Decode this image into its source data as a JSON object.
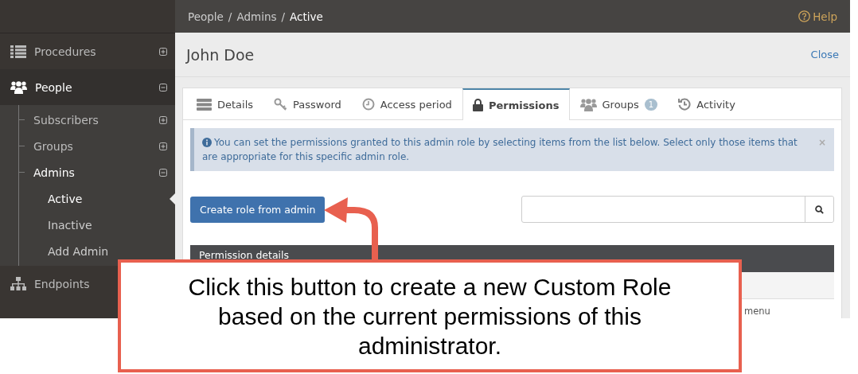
{
  "breadcrumb": [
    {
      "label": "People",
      "current": false
    },
    {
      "separator": "/"
    },
    {
      "label": "Admins",
      "current": false
    },
    {
      "separator": "/"
    },
    {
      "label": "Active",
      "current": true
    }
  ],
  "help": "Help",
  "sidebar": {
    "items": [
      {
        "label": "Procedures",
        "expanded": false
      },
      {
        "label": "People",
        "expanded": true,
        "children": [
          {
            "label": "Subscribers",
            "expanded": false
          },
          {
            "label": "Groups",
            "expanded": false
          },
          {
            "label": "Admins",
            "expanded": true,
            "children": [
              {
                "label": "Active",
                "selected": true
              },
              {
                "label": "Inactive",
                "selected": false
              },
              {
                "label": "Add Admin",
                "selected": false
              }
            ]
          }
        ]
      },
      {
        "label": "Endpoints"
      }
    ]
  },
  "page_title": "John Doe",
  "close": "Close",
  "tabs": [
    {
      "label": "Details",
      "selected": false
    },
    {
      "label": "Password",
      "selected": false
    },
    {
      "label": "Access period",
      "selected": false
    },
    {
      "label": "Permissions",
      "selected": true
    },
    {
      "label": "Groups",
      "selected": false,
      "badge": "1"
    },
    {
      "label": "Activity",
      "selected": false
    }
  ],
  "alert": {
    "text": "You can set the permissions granted to this admin role by selecting items from the list below. Select only those items that are appropriate for this specific admin role.",
    "dismiss": "×"
  },
  "create_button": "Create role from admin",
  "table": {
    "header": "Permission details",
    "row_text": "menu"
  },
  "callout": {
    "text": "Click this button to create a new Custom Role based on the current permissions of this administrator."
  }
}
